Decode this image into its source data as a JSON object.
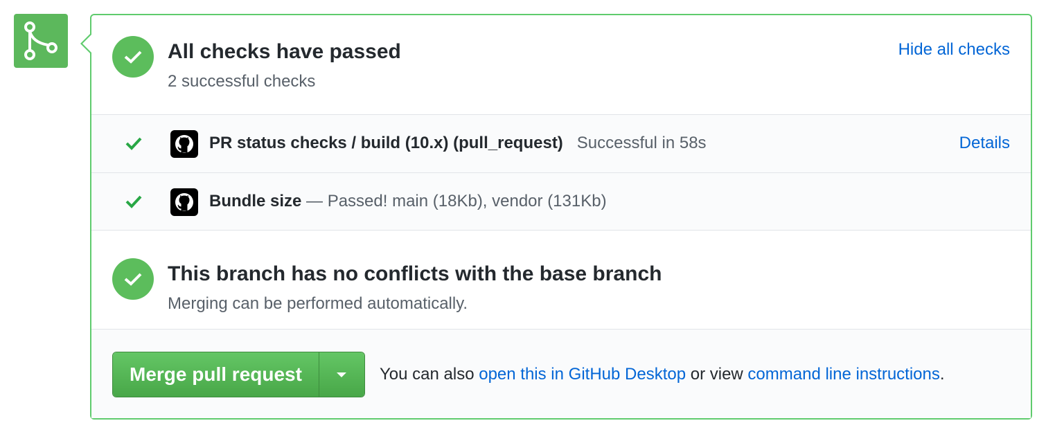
{
  "checks_summary": {
    "title": "All checks have passed",
    "subtitle": "2 successful checks",
    "toggle_link": "Hide all checks"
  },
  "checks": [
    {
      "title": "PR status checks / build (10.x) (pull_request)",
      "status": "Successful in 58s",
      "details_link": "Details"
    },
    {
      "title": "Bundle size",
      "description": " — Passed! main (18Kb), vendor (131Kb)"
    }
  ],
  "branch_status": {
    "title": "This branch has no conflicts with the base branch",
    "subtitle": "Merging can be performed automatically."
  },
  "merge": {
    "button_label": "Merge pull request",
    "note_prefix": "You can also ",
    "desktop_link": "open this in GitHub Desktop",
    "note_middle": " or view ",
    "cli_link": "command line instructions",
    "note_suffix": "."
  },
  "colors": {
    "success_green": "#5cbd5c",
    "border_green": "#5fcb6d",
    "link_blue": "#0366d6"
  },
  "icons": {
    "timeline": "git-merge-icon",
    "status": "check-circle-icon",
    "row_check": "check-icon",
    "app": "github-octocat-icon",
    "dropdown": "triangle-down-icon"
  }
}
